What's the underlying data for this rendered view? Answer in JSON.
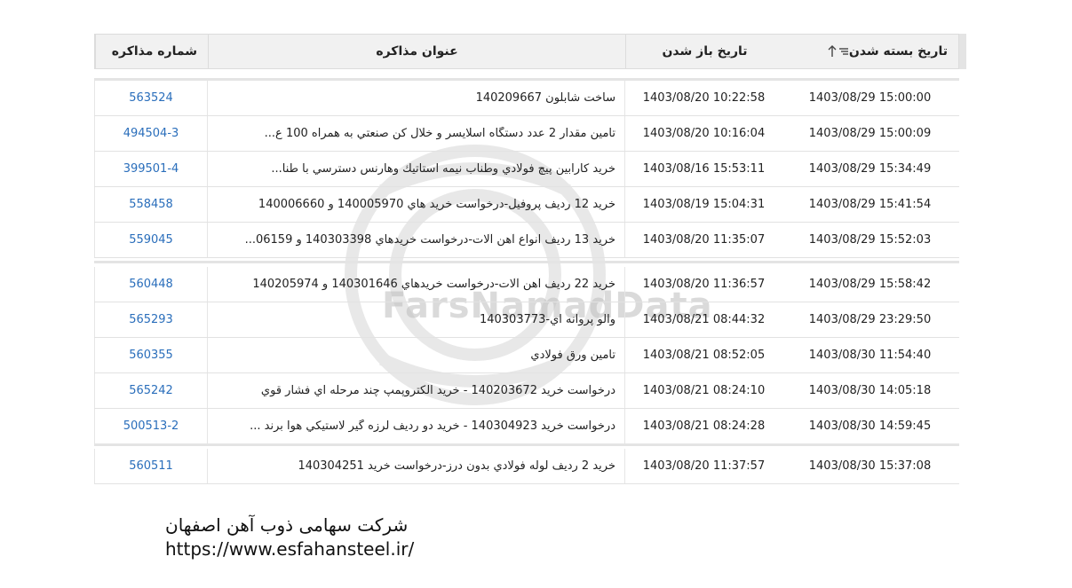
{
  "header": {
    "id": "شماره مذاکره",
    "title": "عنوان مذاکره",
    "open": "تاریخ باز شدن",
    "close": "تاریخ بسته شدن"
  },
  "group1": [
    {
      "id": "563524",
      "title": "ساخت شابلون 140209667",
      "open": "1403/08/20 10:22:58",
      "close": "1403/08/29 15:00:00"
    },
    {
      "id": "494504-3",
      "title": "تامين مقدار 2 عدد دستگاه اسلايسر و خلال كن صنعتي به همراه 100 ع...",
      "open": "1403/08/20 10:16:04",
      "close": "1403/08/29 15:00:09"
    },
    {
      "id": "399501-4",
      "title": "خريد كارابين پيچ فولادي وطناب نيمه استاتيك وهارنس دسترسي با طنا...",
      "open": "1403/08/16 15:53:11",
      "close": "1403/08/29 15:34:49"
    },
    {
      "id": "558458",
      "title": "خريد 12 رديف پروفيل-درخواست خريد هاي 140005970 و 140006660",
      "open": "1403/08/19 15:04:31",
      "close": "1403/08/29 15:41:54"
    },
    {
      "id": "559045",
      "title": "خريد 13 رديف انواع آهن آلات-درخواست خريدهاي 140303398 و 06159...",
      "open": "1403/08/20 11:35:07",
      "close": "1403/08/29 15:52:03"
    }
  ],
  "group2": [
    {
      "id": "560448",
      "title": "خريد 22 رديف آهن آلات-درخواست خريدهاي 140301646 و 140205974",
      "open": "1403/08/20 11:36:57",
      "close": "1403/08/29 15:58:42"
    },
    {
      "id": "565293",
      "title": "والو پروانه اي-140303773",
      "open": "1403/08/21 08:44:32",
      "close": "1403/08/29 23:29:50"
    },
    {
      "id": "560355",
      "title": "تامين ورق فولادي",
      "open": "1403/08/21 08:52:05",
      "close": "1403/08/30 11:54:40"
    },
    {
      "id": "565242",
      "title": "درخواست خريد 140203672 - خريد الكتروپمپ چند مرحله اي فشار قوي",
      "open": "1403/08/21 08:24:10",
      "close": "1403/08/30 14:05:18"
    },
    {
      "id": "500513-2",
      "title": "درخواست خريد 140304923 - خريد دو رديف لرزه گير لاستيكي هوا برند ...",
      "open": "1403/08/21 08:24:28",
      "close": "1403/08/30 14:59:45"
    }
  ],
  "group3": [
    {
      "id": "560511",
      "title": "خريد 2 رديف لوله فولادي بدون درز-درخواست خريد 140304251",
      "open": "1403/08/20 11:37:57",
      "close": "1403/08/30 15:37:08"
    }
  ],
  "footer": {
    "company": "شرکت سهامی ذوب آهن اصفهان",
    "url": "https://www.esfahansteel.ir/"
  },
  "watermark": {
    "brand": "FarsNamadData"
  }
}
